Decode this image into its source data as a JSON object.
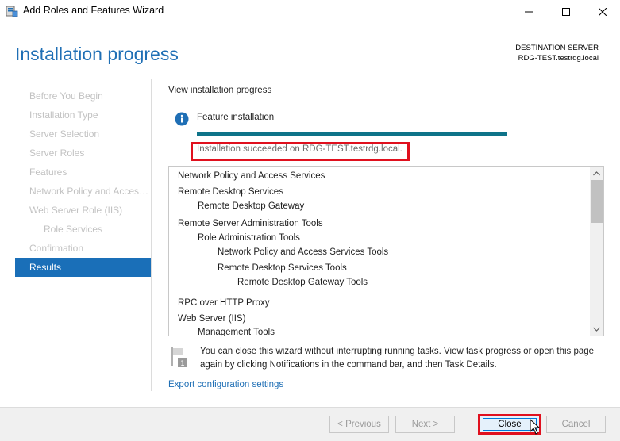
{
  "window": {
    "title": "Add Roles and Features Wizard"
  },
  "header": {
    "title": "Installation progress",
    "destination_label": "DESTINATION SERVER",
    "destination_value": "RDG-TEST.testrdg.local"
  },
  "sidebar": {
    "items": [
      {
        "label": "Before You Begin"
      },
      {
        "label": "Installation Type"
      },
      {
        "label": "Server Selection"
      },
      {
        "label": "Server Roles"
      },
      {
        "label": "Features"
      },
      {
        "label": "Network Policy and Access Services"
      },
      {
        "label": "Web Server Role (IIS)"
      },
      {
        "label": "Role Services"
      },
      {
        "label": "Confirmation"
      },
      {
        "label": "Results"
      }
    ]
  },
  "main": {
    "heading": "View installation progress",
    "feature_label": "Feature installation",
    "progress_fraction": 1.0,
    "success_text": "Installation succeeded on RDG-TEST.testrdg.local.",
    "results": [
      "Network Policy and Access Services",
      "Remote Desktop Services",
      "Remote Desktop Gateway",
      "Remote Server Administration Tools",
      "Role Administration Tools",
      "Network Policy and Access Services Tools",
      "Remote Desktop Services Tools",
      "Remote Desktop Gateway Tools",
      "RPC over HTTP Proxy",
      "Web Server (IIS)",
      "Management Tools"
    ],
    "notice_text": "You can close this wizard without interrupting running tasks. View task progress or open this page again by clicking Notifications in the command bar, and then Task Details.",
    "export_link": "Export configuration settings"
  },
  "footer": {
    "previous_label": "< Previous",
    "next_label": "Next >",
    "close_label": "Close",
    "cancel_label": "Cancel"
  },
  "colors": {
    "accent": "#1f6fb5",
    "progress": "#0e7389",
    "highlight": "#e0101e"
  }
}
